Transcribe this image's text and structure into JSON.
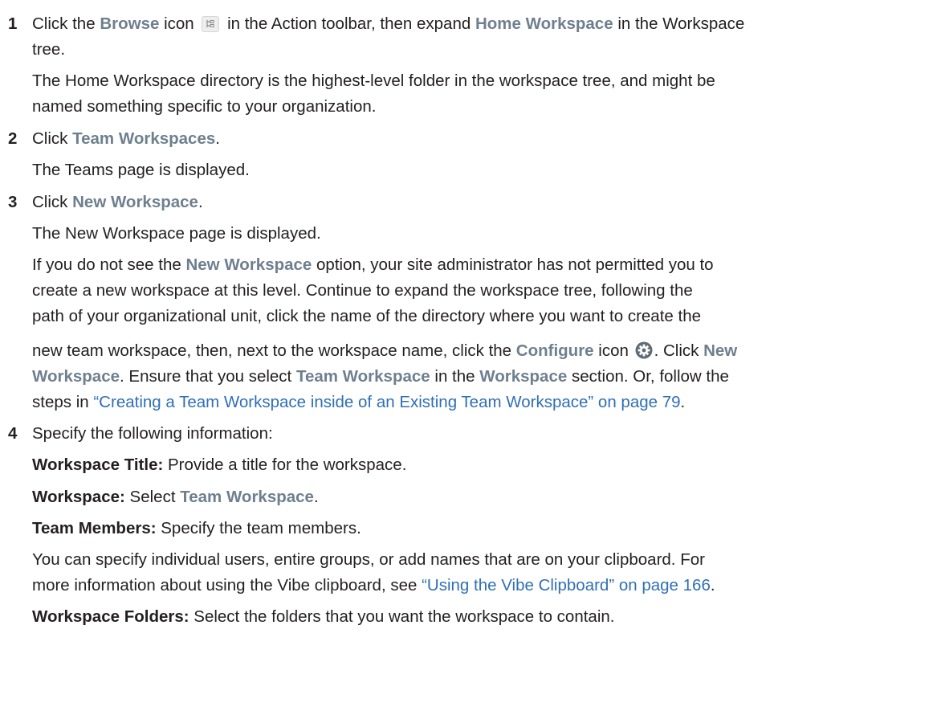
{
  "step1": {
    "num": "1",
    "t1": "Click the ",
    "browse": "Browse",
    "t2": " icon ",
    "t3": " in the Action toolbar, then expand ",
    "home_ws": "Home Workspace",
    "t4": " in the Workspace",
    "t5": "tree.",
    "p1": "The Home Workspace directory is the highest-level folder in the workspace tree, and might be",
    "p2": "named something specific to your organization."
  },
  "step2": {
    "num": "2",
    "t1": "Click ",
    "team_ws": "Team Workspaces",
    "t2": ".",
    "p1": "The Teams page is displayed."
  },
  "step3": {
    "num": "3",
    "t1": "Click ",
    "new_ws": "New Workspace",
    "t2": ".",
    "p1": "The New Workspace page is displayed.",
    "q1a": "If you do not see the ",
    "q1b": "New Workspace",
    "q1c": " option, your site administrator has not permitted you to",
    "q2": "create a new workspace at this level. Continue to expand the workspace tree, following the",
    "q3": "path of your organizational unit, click the name of the directory where you want to create the",
    "q4a": "new team workspace, then, next to the workspace name, click the ",
    "q4b": "Configure",
    "q4c": " icon ",
    "q4d": ". Click ",
    "q4e": "New",
    "q5a": "Workspace",
    "q5b": ". Ensure that you select ",
    "q5c": "Team Workspace",
    "q5d": " in the ",
    "q5e": "Workspace",
    "q5f": " section. Or, follow the",
    "q6a": "steps in ",
    "q6b": "“Creating a Team Workspace inside of an Existing Team Workspace” on page 79",
    "q6c": "."
  },
  "step4": {
    "num": "4",
    "t1": "Specify the following information:",
    "f1_term": "Workspace Title:",
    "f1_text": " Provide a title for the workspace.",
    "f2_term": "Workspace:",
    "f2_text": " Select ",
    "f2_ui": "Team Workspace",
    "f2_end": ".",
    "f3_term": "Team Members:",
    "f3_text": " Specify the team members.",
    "p1": "You can specify individual users, entire groups, or add names that are on your clipboard. For",
    "p2a": "more information about using the Vibe clipboard, see ",
    "p2b": "“Using the Vibe Clipboard” on page 166",
    "p2c": ".",
    "f4_term": "Workspace Folders:",
    "f4_text": " Select the folders that you want the workspace to contain."
  },
  "colors": {
    "ui_label": "#6e7f8f",
    "link": "#2f6fb6",
    "text": "#231f20"
  },
  "icons": [
    "browse-tree-icon",
    "gear-icon"
  ]
}
